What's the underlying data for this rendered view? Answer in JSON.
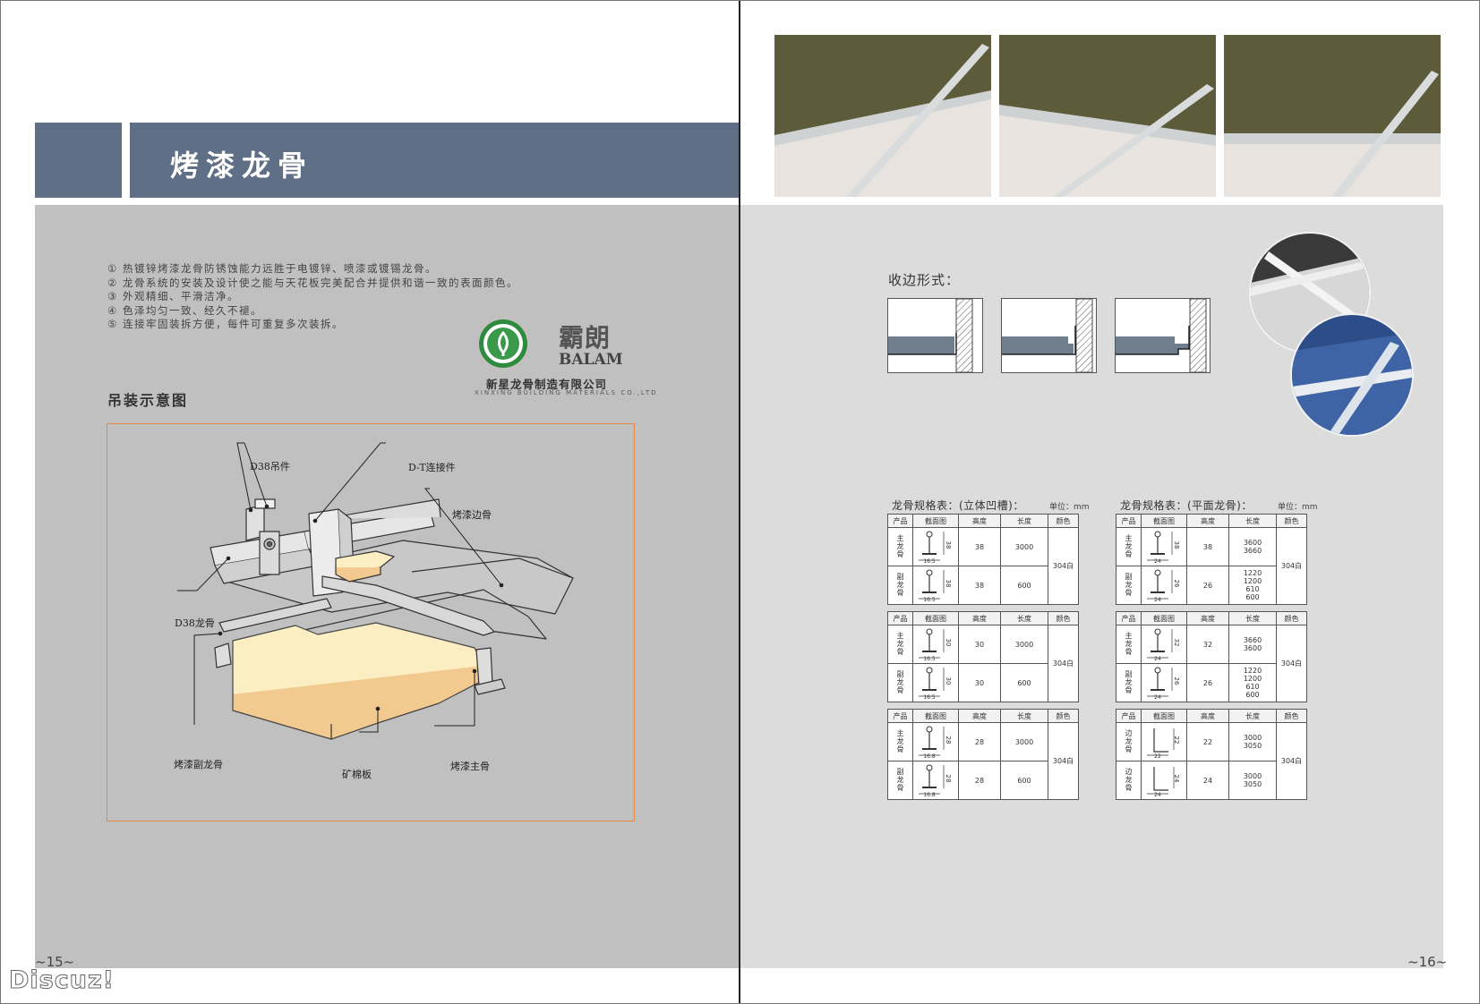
{
  "left_page": {
    "title": "烤漆龙骨",
    "features": [
      "① 热镀锌烤漆龙骨防锈蚀能力远胜于电镀锌、喷漆或镀锡龙骨。",
      "② 龙骨系统的安装及设计使之能与天花板完美配合并提供和谐一致的表面颜色。",
      "③ 外观精细、平滑洁净。",
      "④ 色泽均匀一致、经久不褪。",
      "⑤ 连接牢固装拆方便，每件可重复多次装拆。"
    ],
    "logo": {
      "brand_cn": "霸朗",
      "brand_en": "BALAM",
      "company_cn": "新星龙骨制造有限公司",
      "company_en": "XINXING BUILDING MATERIALS CO.,LTD"
    },
    "diagram_heading": "吊装示意图",
    "diagram_labels": {
      "hanger": "D38吊件",
      "connector": "D-T连接件",
      "edge": "烤漆边骨",
      "carrier": "D38龙骨",
      "cross": "烤漆副龙骨",
      "board": "矿棉板",
      "main": "烤漆主骨"
    },
    "page_number": "~15~"
  },
  "right_page": {
    "edge_heading": "收边形式：",
    "page_number": "~16~",
    "tables": [
      {
        "title": "龙骨规格表：(立体凹槽)：",
        "unit": "单位：mm",
        "headers": [
          "产品",
          "截面图",
          "高度",
          "长度",
          "颜色"
        ],
        "groups": [
          {
            "color": "304白",
            "rows": [
              {
                "product": "主龙骨",
                "height": "38",
                "length": [
                  "3000"
                ],
                "dim_h": "38",
                "dim_w": "16.5"
              },
              {
                "product": "副龙骨",
                "height": "38",
                "length": [
                  "600"
                ],
                "dim_h": "38",
                "dim_w": "16.5"
              }
            ]
          },
          {
            "color": "304白",
            "rows": [
              {
                "product": "主龙骨",
                "height": "30",
                "length": [
                  "3000"
                ],
                "dim_h": "30",
                "dim_w": "16.5"
              },
              {
                "product": "副龙骨",
                "height": "30",
                "length": [
                  "600"
                ],
                "dim_h": "30",
                "dim_w": "16.5"
              }
            ]
          },
          {
            "color": "304白",
            "rows": [
              {
                "product": "主龙骨",
                "height": "28",
                "length": [
                  "3000"
                ],
                "dim_h": "28",
                "dim_w": "16.8"
              },
              {
                "product": "副龙骨",
                "height": "28",
                "length": [
                  "600"
                ],
                "dim_h": "28",
                "dim_w": "16.8"
              }
            ]
          }
        ]
      },
      {
        "title": "龙骨规格表：(平面龙骨)：",
        "unit": "单位：mm",
        "headers": [
          "产品",
          "截面图",
          "高度",
          "长度",
          "颜色"
        ],
        "groups": [
          {
            "color": "304白",
            "rows": [
              {
                "product": "主龙骨",
                "height": "38",
                "length": [
                  "3600",
                  "3660"
                ],
                "dim_h": "38",
                "dim_w": "24"
              },
              {
                "product": "副龙骨",
                "height": "26",
                "length": [
                  "1220",
                  "1200",
                  "610",
                  "600"
                ],
                "dim_h": "26",
                "dim_w": "24"
              }
            ]
          },
          {
            "color": "304白",
            "rows": [
              {
                "product": "主龙骨",
                "height": "32",
                "length": [
                  "3660",
                  "3600"
                ],
                "dim_h": "32",
                "dim_w": "24"
              },
              {
                "product": "副龙骨",
                "height": "26",
                "length": [
                  "1220",
                  "1200",
                  "610",
                  "600"
                ],
                "dim_h": "26",
                "dim_w": "24"
              }
            ]
          },
          {
            "color": "304白",
            "rows": [
              {
                "product": "边龙骨",
                "height": "22",
                "length": [
                  "3000",
                  "3050"
                ],
                "dim_h": "22",
                "dim_w": "22"
              },
              {
                "product": "边龙骨",
                "height": "24",
                "length": [
                  "3000",
                  "3050"
                ],
                "dim_h": "24",
                "dim_w": "24"
              }
            ]
          }
        ]
      }
    ]
  },
  "watermark": "Discuz!"
}
